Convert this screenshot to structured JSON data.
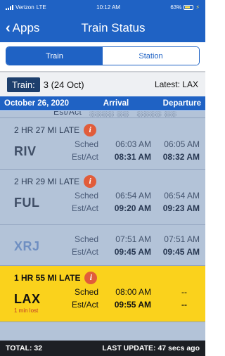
{
  "status_bar": {
    "carrier": "Verizon",
    "network": "LTE",
    "time": "10:12 AM",
    "battery": "63%"
  },
  "nav": {
    "back_label": "Apps",
    "title": "Train Status"
  },
  "segments": [
    {
      "label": "Train",
      "selected": true
    },
    {
      "label": "Station",
      "selected": false
    }
  ],
  "train_row": {
    "button_label": "Train:",
    "train_value": "3 (24 Oct)",
    "latest": "Latest: LAX"
  },
  "table_header": {
    "date": "October 26, 2020",
    "arrival": "Arrival",
    "departure": "Departure"
  },
  "stops": [
    {
      "code": "RIV",
      "late": "2 HR 27 MI LATE",
      "sched_label": "Sched",
      "est_label": "Est/Act",
      "sched_arrival": "06:03 AM",
      "sched_departure": "06:05 AM",
      "act_arrival": "08:31 AM",
      "act_departure": "08:32 AM"
    },
    {
      "code": "FUL",
      "late": "2 HR 29 MI LATE",
      "sched_label": "Sched",
      "est_label": "Est/Act",
      "sched_arrival": "06:54 AM",
      "sched_departure": "06:54 AM",
      "act_arrival": "09:20 AM",
      "act_departure": "09:23 AM"
    },
    {
      "code": "XRJ",
      "sched_label": "Sched",
      "est_label": "Est/Act",
      "sched_arrival": "07:51 AM",
      "sched_departure": "07:51 AM",
      "act_arrival": "09:45 AM",
      "act_departure": "09:45 AM"
    },
    {
      "code": "LAX",
      "late": "1 HR 55 MI LATE",
      "min_lost": "1 min lost",
      "sched_label": "Sched",
      "est_label": "Est/Act",
      "sched_arrival": "08:00 AM",
      "sched_departure": "--",
      "act_arrival": "09:55 AM",
      "act_departure": "--"
    }
  ],
  "footer": {
    "total": "TOTAL: 32",
    "last_update": "LAST UPDATE: 47 secs ago"
  },
  "colors": {
    "primary": "#1f62c4",
    "row_bg": "#b3c3d8",
    "highlight": "#fad21c",
    "info_icon": "#e15c3a",
    "footer_bg": "#1d1f24"
  },
  "icons": [
    "signal-bars-icon",
    "battery-icon",
    "chevron-left-icon",
    "info-icon"
  ]
}
